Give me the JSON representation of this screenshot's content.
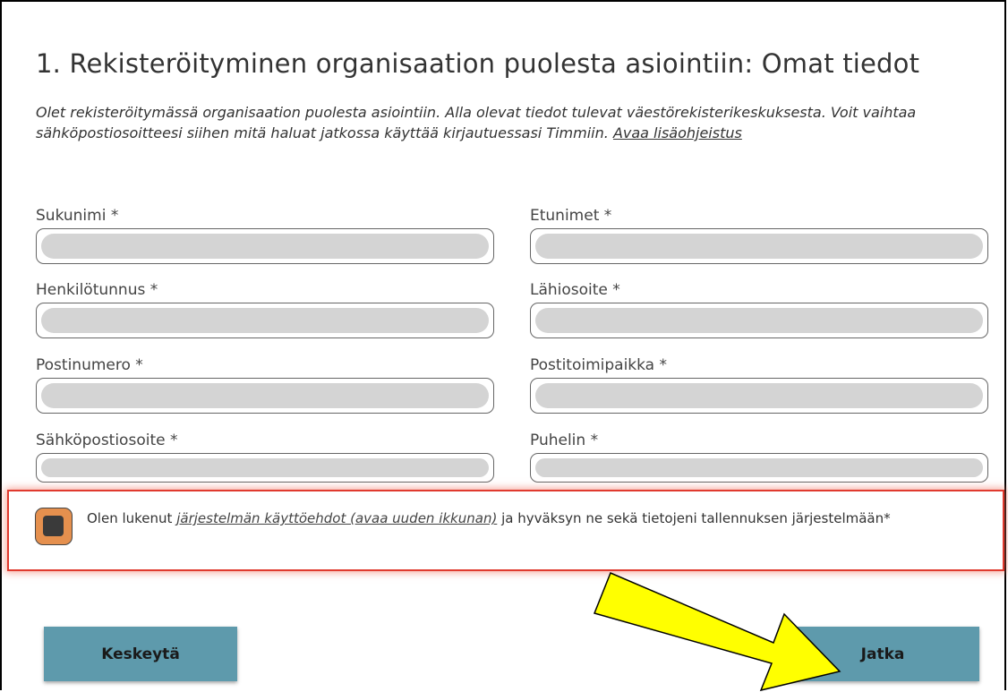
{
  "page": {
    "title": "1. Rekisteröityminen organisaation puolesta asiointiin: Omat tiedot",
    "intro": "Olet rekisteröitymässä organisaation puolesta asiointiin. Alla olevat tiedot tulevat väestörekisterikeskuksesta. Voit vaihtaa sähköpostiosoitteesi siihen mitä haluat jatkossa käyttää kirjautuessasi Timmiin.",
    "help_link": "Avaa lisäohjeistus"
  },
  "fields": {
    "surname": {
      "label": "Sukunimi *",
      "value": ""
    },
    "firstnames": {
      "label": "Etunimet *",
      "value": ""
    },
    "ssn": {
      "label": "Henkilötunnus *",
      "value": ""
    },
    "address": {
      "label": "Lähiosoite *",
      "value": ""
    },
    "postal_code": {
      "label": "Postinumero *",
      "value": ""
    },
    "city": {
      "label": "Postitoimipaikka *",
      "value": ""
    },
    "email": {
      "label": "Sähköpostiosoite *",
      "value": ""
    },
    "phone": {
      "label": "Puhelin *",
      "value": ""
    }
  },
  "consent": {
    "text_before": "Olen lukenut",
    "link": "järjestelmän käyttöehdot (avaa uuden ikkunan)",
    "text_after": "ja hyväksyn ne sekä tietojeni tallennuksen järjestelmään*"
  },
  "buttons": {
    "cancel": "Keskeytä",
    "next": "Jatka"
  },
  "colors": {
    "button": "#5e9aac",
    "checkbox": "#e5904e",
    "highlight_border": "#e03a2e",
    "arrow_fill": "#ffff00"
  }
}
